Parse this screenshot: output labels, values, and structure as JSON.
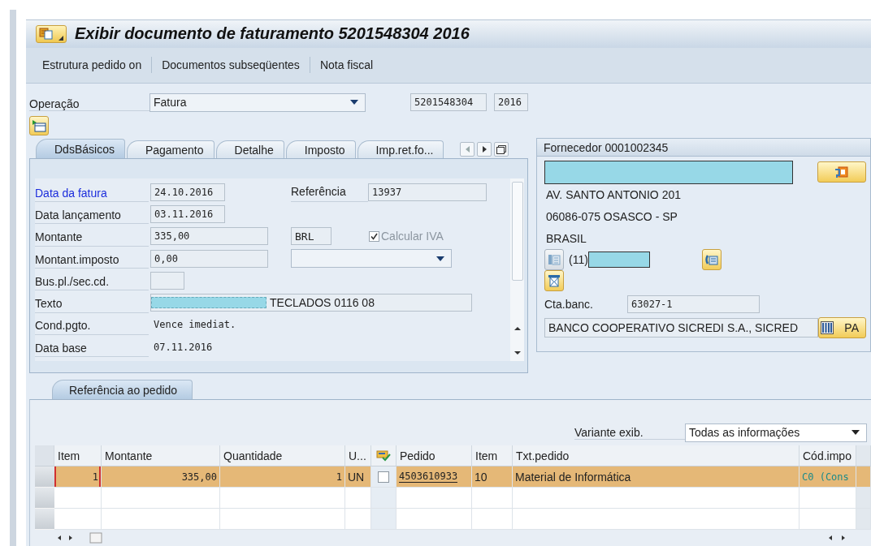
{
  "window": {
    "title": "Exibir documento de faturamento 5201548304 2016"
  },
  "toolbar": [
    "Estrutura pedido on",
    "Documentos subseqüentes",
    "Nota fiscal"
  ],
  "header": {
    "operation_label": "Operação",
    "operation_value": "Fatura",
    "document_number": "5201548304",
    "year": "2016"
  },
  "tabs": [
    {
      "label": "DdsBásicos",
      "selected": true
    },
    {
      "label": "Pagamento",
      "selected": false
    },
    {
      "label": "Detalhe",
      "selected": false
    },
    {
      "label": "Imposto",
      "selected": false
    },
    {
      "label": "Imp.ret.fo...",
      "selected": false
    }
  ],
  "basic_data": [
    {
      "label": "Data da fatura",
      "highlighted": true,
      "field": {
        "kind": "date",
        "value": "24.10.2016"
      },
      "extra": {
        "kind": "labeled",
        "label": "Referência",
        "value": "13937"
      }
    },
    {
      "label": "Data lançamento",
      "highlighted": false,
      "field": {
        "kind": "date",
        "value": "03.11.2016"
      }
    },
    {
      "label": "Montante",
      "highlighted": false,
      "field": {
        "kind": "amount",
        "value": "335,00"
      },
      "extra": {
        "kind": "currency",
        "value": "BRL",
        "checkbox": {
          "label": "Calcular IVA",
          "checked": true,
          "disabled": true
        }
      }
    },
    {
      "label": "Montant.imposto",
      "highlighted": false,
      "field": {
        "kind": "amount",
        "value": "0,00"
      },
      "extra": {
        "kind": "dropdown"
      }
    },
    {
      "label": "Bus.pl./sec.cd.",
      "highlighted": false,
      "field": {
        "kind": "tiny"
      }
    },
    {
      "label": "Texto",
      "highlighted": false,
      "field": {
        "kind": "text",
        "value": "TECLADOS 0116 08",
        "redacted": true
      }
    },
    {
      "label": "Cond.pgto.",
      "highlighted": false,
      "field": {
        "kind": "display",
        "value": "Vence imediat."
      }
    },
    {
      "label": "Data base",
      "highlighted": false,
      "field": {
        "kind": "display",
        "value": "07.11.2016"
      }
    }
  ],
  "vendor": {
    "title": "Fornecedor 0001002345",
    "name_redacted": true,
    "address": [
      "AV. SANTO ANTONIO 201",
      "06086-075 OSASCO - SP",
      "BRASIL"
    ],
    "phone_prefix": "(11)",
    "phone_redacted": true,
    "bank_label": "Cta.banc.",
    "bank_account": "63027-1",
    "bank_name": "BANCO COOPERATIVO SICREDI S.A., SICRED",
    "bank_button": "PA"
  },
  "po_reference": {
    "tab": {
      "label": "Referência ao pedido",
      "selected": true
    },
    "layout_label": "Variante exib.",
    "layout_value": "Todas as informações",
    "table": {
      "columns": [
        {
          "kind": "text",
          "label": "Item"
        },
        {
          "kind": "text",
          "label": "Montante"
        },
        {
          "kind": "text",
          "label": "Quantidade"
        },
        {
          "kind": "text",
          "label": "U..."
        },
        {
          "kind": "icon"
        },
        {
          "kind": "text",
          "label": "Pedido"
        },
        {
          "kind": "text",
          "label": "Item"
        },
        {
          "kind": "text",
          "label": "Txt.pedido"
        },
        {
          "kind": "text",
          "label": "Cód.impo"
        }
      ],
      "rows": [
        {
          "selected": true,
          "cells": [
            {
              "kind": "number",
              "value": "1",
              "focused": true
            },
            {
              "kind": "number",
              "value": "335,00"
            },
            {
              "kind": "number",
              "value": "1"
            },
            {
              "kind": "text",
              "value": "UN"
            },
            {
              "kind": "checkbox",
              "checked": false
            },
            {
              "kind": "link",
              "value": "4503610933"
            },
            {
              "kind": "text",
              "value": "10"
            },
            {
              "kind": "text",
              "value": "Material de Informática"
            },
            {
              "kind": "code",
              "value": "C0  (Cons"
            }
          ]
        }
      ]
    }
  }
}
